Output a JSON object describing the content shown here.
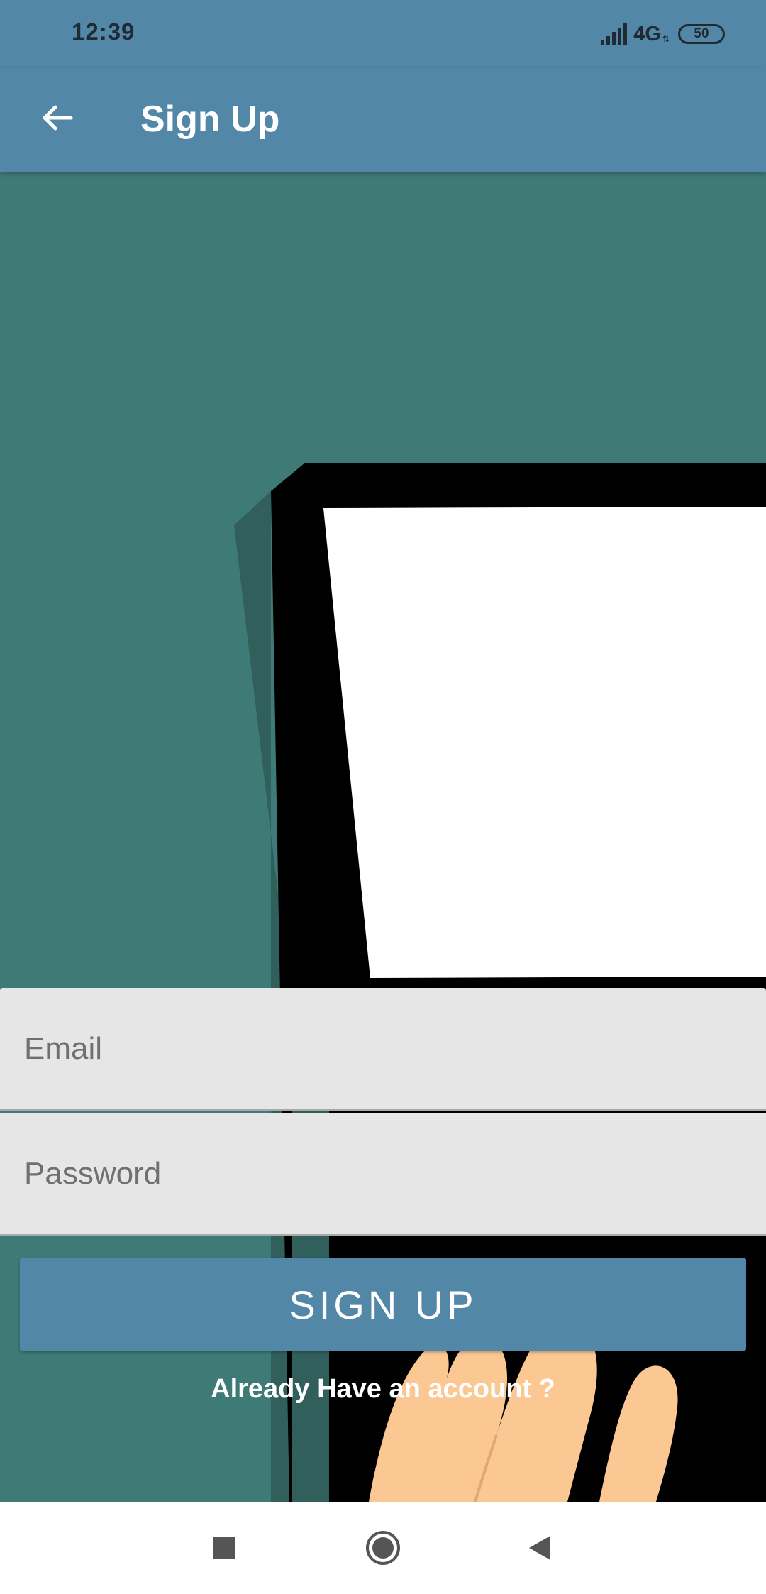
{
  "status_bar": {
    "time": "12:39",
    "network": "4G",
    "battery": "50",
    "icons": [
      "signal-icon",
      "battery-icon"
    ]
  },
  "app_bar": {
    "title": "Sign Up",
    "back_icon": "arrow-left-icon"
  },
  "form": {
    "email": {
      "placeholder": "Email",
      "value": ""
    },
    "password": {
      "placeholder": "Password",
      "value": ""
    },
    "submit_label": "SIGN UP",
    "account_link": "Already Have an account ?"
  },
  "nav_bar": {
    "icons": [
      "recent-apps-icon",
      "home-icon",
      "back-triangle-icon"
    ]
  },
  "colors": {
    "primary": "#5287a8",
    "background": "#3f7b76",
    "field": "#e6e6e6"
  }
}
